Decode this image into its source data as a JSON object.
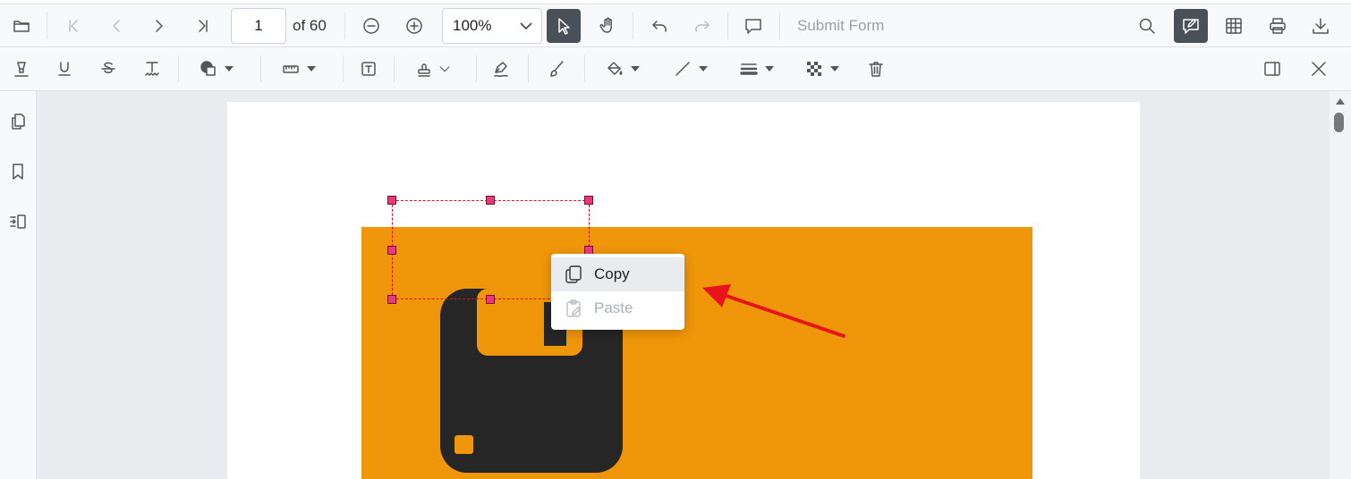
{
  "toolbar": {
    "current_page": "1",
    "page_count_label": "of 60",
    "zoom_value": "100%",
    "submit_form_label": "Submit Form"
  },
  "context_menu": {
    "copy_label": "Copy",
    "paste_label": "Paste"
  },
  "colors": {
    "accent_active": "#495057",
    "page_banner": "#f0960a",
    "selection_border": "#e0101a",
    "annotation_arrow": "#e8141c"
  }
}
